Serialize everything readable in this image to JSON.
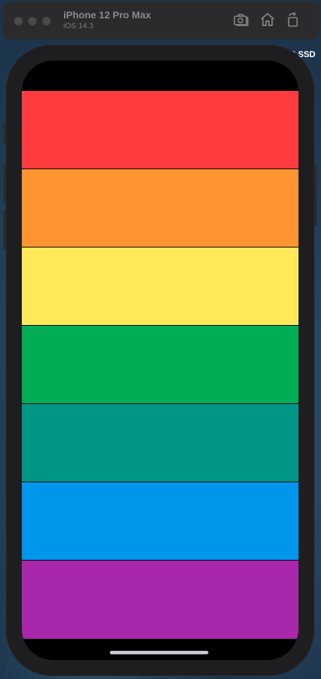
{
  "simulator": {
    "device_name": "iPhone 12 Pro Max",
    "os_version": "iOS 14.3",
    "icons": [
      "screenshot-icon",
      "home-icon",
      "rotate-icon"
    ]
  },
  "background": {
    "label": "S SSD"
  },
  "app": {
    "stripes": [
      {
        "name": "red-stripe",
        "color": "#ff3b3f"
      },
      {
        "name": "orange-stripe",
        "color": "#ff9530"
      },
      {
        "name": "yellow-stripe",
        "color": "#ffe959"
      },
      {
        "name": "green-stripe",
        "color": "#00ad55"
      },
      {
        "name": "teal-stripe",
        "color": "#009685"
      },
      {
        "name": "blue-stripe",
        "color": "#0096ec"
      },
      {
        "name": "purple-stripe",
        "color": "#a827ab"
      }
    ]
  }
}
